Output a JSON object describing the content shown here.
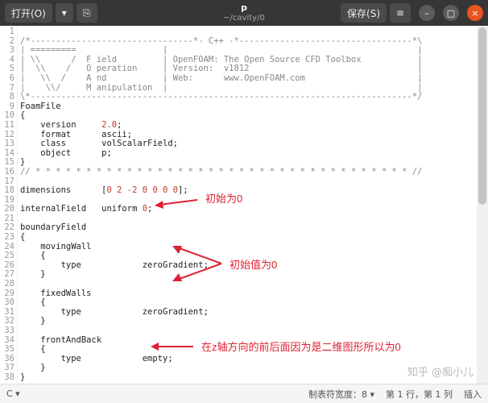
{
  "titlebar": {
    "open_label": "打开(O)",
    "dropdown_glyph": "▾",
    "newtab_glyph": "⎘",
    "title_name": "p",
    "title_path": "~/cavity/0",
    "save_label": "保存(S)",
    "menu_glyph": "≡",
    "min_glyph": "–",
    "max_glyph": "□",
    "close_glyph": "×"
  },
  "gutter_lines": [
    "1",
    "2",
    "3",
    "4",
    "5",
    "6",
    "7",
    "8",
    "9",
    "10",
    "11",
    "12",
    "13",
    "14",
    "15",
    "16",
    "17",
    "18",
    "19",
    "20",
    "21",
    "22",
    "23",
    "24",
    "25",
    "26",
    "27",
    "28",
    "29",
    "30",
    "31",
    "32",
    "33",
    "34",
    "35",
    "36",
    "37",
    "38"
  ],
  "code": {
    "l1": "/*--------------------------------*- C++ -*----------------------------------*\\",
    "l2": "| =========                 |                                                 |",
    "l3": "| \\\\      /  F ield         | OpenFOAM: The Open Source CFD Toolbox           |",
    "l4": "|  \\\\    /   O peration     | Version:  v1812                                 |",
    "l5": "|   \\\\  /    A nd           | Web:      www.OpenFOAM.com                      |",
    "l6": "|    \\\\/     M anipulation  |                                                 |",
    "l7": "\\*---------------------------------------------------------------------------*/",
    "l8": "FoamFile",
    "l9": "{",
    "l10a": "    version     ",
    "l10n": "2.0",
    "l10b": ";",
    "l11": "    format      ascii;",
    "l12": "    class       volScalarField;",
    "l13": "    object      p;",
    "l14": "}",
    "l15": "// * * * * * * * * * * * * * * * * * * * * * * * * * * * * * * * * * * * * * //",
    "l16": "",
    "l17a": "dimensions      [",
    "l17n": "0 2 -2 0 0 0 0",
    "l17b": "];",
    "l18": "",
    "l19a": "internalField   uniform ",
    "l19n": "0",
    "l19b": ";",
    "l20": "",
    "l21": "boundaryField",
    "l22": "{",
    "l23": "    movingWall",
    "l24": "    {",
    "l25": "        type            zeroGradient;",
    "l26": "    }",
    "l27": "",
    "l28": "    fixedWalls",
    "l29": "    {",
    "l30": "        type            zeroGradient;",
    "l31": "    }",
    "l32": "",
    "l33": "    frontAndBack",
    "l34": "    {",
    "l35": "        type            empty;",
    "l36": "    }",
    "l37": "}",
    "l38": ""
  },
  "annotations": {
    "a1": "初始为0",
    "a2": "初始值为0",
    "a3": "在z轴方向的前后面因为是二维图形所以为0"
  },
  "statusbar": {
    "lang": "C ▾",
    "tabw": "制表符宽度：8 ▾",
    "pos": "第 1 行，第 1 列",
    "mode": "插入"
  },
  "watermark": "知乎 @痴小儿"
}
